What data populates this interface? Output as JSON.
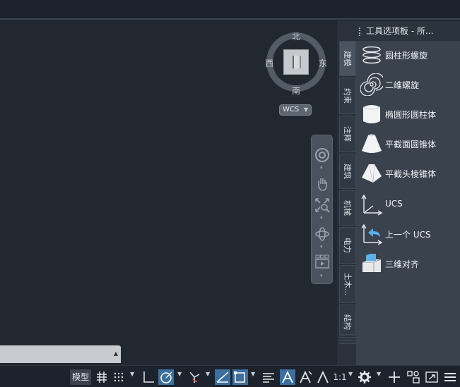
{
  "viewcube": {
    "north": "北",
    "south": "南",
    "east": "东",
    "west": "西",
    "cube_label": "上",
    "wcs_label": "WCS"
  },
  "palette": {
    "title": "工具选项板 - 所...",
    "tabs": [
      "建模",
      "约束",
      "注释",
      "建筑",
      "机械",
      "电力",
      "土木...",
      "结构"
    ],
    "items": [
      "圆柱形螺旋",
      "二维螺旋",
      "椭圆形圆柱体",
      "平截面圆锥体",
      "平截头棱锥体",
      "UCS",
      "上一个 UCS",
      "三维对齐"
    ]
  },
  "statusbar": {
    "model_label": "模型",
    "scale_label": "1:1"
  },
  "colors": {
    "background": "#212830",
    "palette_bg": "#3a424e",
    "accent_blue": "#3c6f9e"
  }
}
